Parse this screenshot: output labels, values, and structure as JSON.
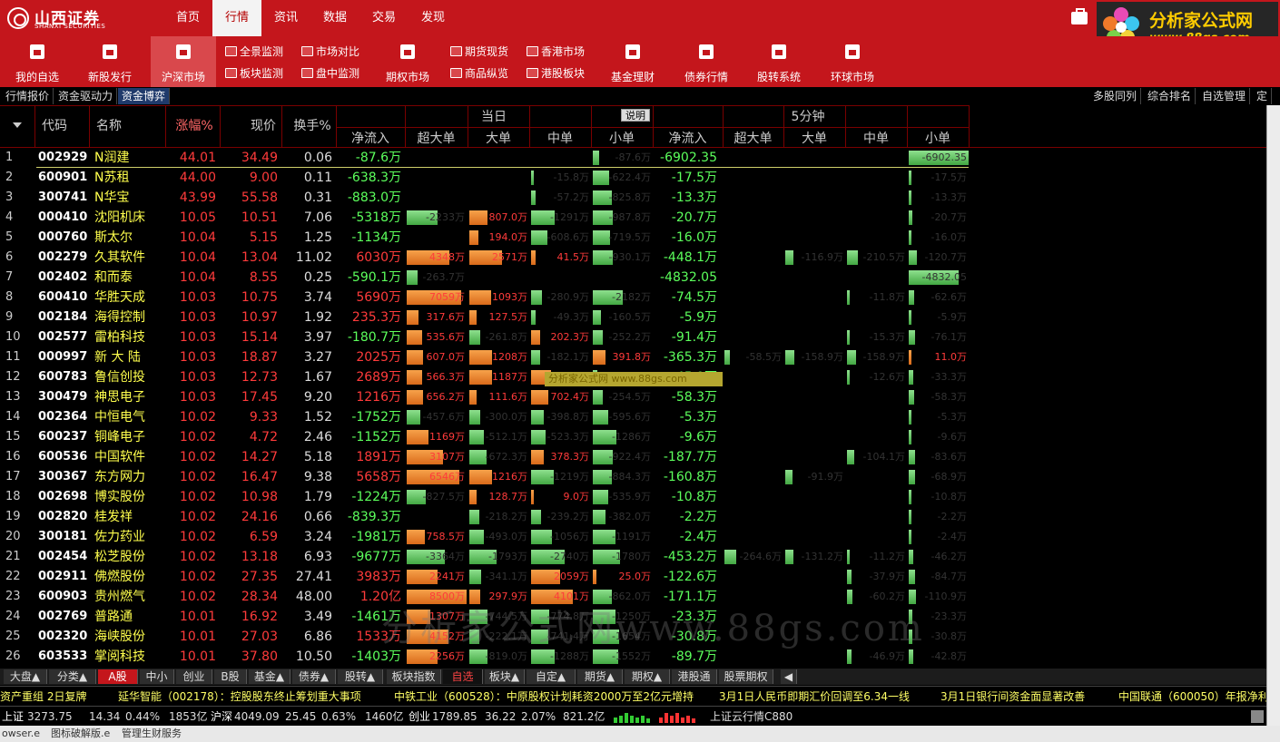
{
  "header": {
    "logo_cn": "山西证券",
    "logo_en": "SHANXI SECURITIES",
    "nav": [
      "首页",
      "行情",
      "资讯",
      "数据",
      "交易",
      "发现"
    ],
    "nav_active": 1,
    "brand_title": "分析家公式网",
    "brand_url": "www.88gs.com"
  },
  "toolbar": {
    "big": [
      {
        "label": "我的自选",
        "icon": "home-icon"
      },
      {
        "label": "新股发行",
        "icon": "document-icon"
      },
      {
        "label": "沪深市场",
        "icon": "chart-icon"
      },
      {
        "label": "期权市场",
        "icon": "options-icon"
      },
      {
        "label": "基金理财",
        "icon": "fund-icon"
      },
      {
        "label": "债券行情",
        "icon": "bond-icon"
      },
      {
        "label": "股转系统",
        "icon": "transfer-icon"
      },
      {
        "label": "环球市场",
        "icon": "globe-icon"
      }
    ],
    "small": [
      "全景监测",
      "板块监测",
      "市场对比",
      "盘中监测",
      "期货现货",
      "商品纵览",
      "香港市场",
      "港股板块"
    ]
  },
  "subtabs": {
    "left": [
      "行情报价",
      "资金驱动力",
      "资金博弈"
    ],
    "right": [
      "多股同列",
      "综合排名",
      "自选管理",
      "定"
    ]
  },
  "table": {
    "headers": {
      "code": "代码",
      "name": "名称",
      "chg": "涨幅%",
      "price": "现价",
      "turnover": "换手%",
      "today": "当日",
      "explain": "说明",
      "five": "5分钟",
      "net": "净流入",
      "xl": "超大单",
      "l": "大单",
      "m": "中单",
      "s": "小单"
    },
    "rows": [
      {
        "i": "1",
        "code": "002929",
        "name": "N润建",
        "chg": "44.01",
        "price": "34.49",
        "to": "0.06",
        "net": "-87.6万",
        "d": [
          "",
          "",
          "",
          "-87.6万"
        ],
        "f": [
          "-6902.35",
          "",
          "",
          "",
          ""
        ],
        "fv": [
          "",
          "",
          "",
          "-6902.35"
        ]
      },
      {
        "i": "2",
        "code": "600901",
        "name": "N苏租",
        "chg": "44.00",
        "price": "9.00",
        "to": "0.11",
        "net": "-638.3万",
        "d": [
          "",
          "",
          "-15.8万",
          "-622.4万"
        ],
        "f": [
          "-17.5万"
        ],
        "fv": [
          "",
          "",
          "",
          "-17.5万"
        ]
      },
      {
        "i": "3",
        "code": "300741",
        "name": "N华宝",
        "chg": "43.99",
        "price": "55.58",
        "to": "0.31",
        "net": "-883.0万",
        "d": [
          "",
          "",
          "-57.2万",
          "-825.8万"
        ],
        "f": [
          "-13.3万"
        ],
        "fv": [
          "",
          "",
          "",
          "-13.3万"
        ]
      },
      {
        "i": "4",
        "code": "000410",
        "name": "沈阳机床",
        "chg": "10.05",
        "price": "10.51",
        "to": "7.06",
        "net": "-5318万",
        "d": [
          "-2233万",
          "807.0万",
          "-1291万",
          "-987.8万"
        ],
        "f": [
          "-20.7万"
        ],
        "fv": [
          "",
          "",
          "",
          "-20.7万"
        ]
      },
      {
        "i": "5",
        "code": "000760",
        "name": "斯太尔",
        "chg": "10.04",
        "price": "5.15",
        "to": "1.25",
        "net": "-1134万",
        "d": [
          "",
          "194.0万",
          "-608.6万",
          "-719.5万"
        ],
        "f": [
          "-16.0万"
        ],
        "fv": [
          "",
          "",
          "",
          "-16.0万"
        ]
      },
      {
        "i": "6",
        "code": "002279",
        "name": "久其软件",
        "chg": "10.04",
        "price": "13.04",
        "to": "11.02",
        "net": "6030万",
        "d": [
          "4348万",
          "2571万",
          "41.5万",
          "-930.1万"
        ],
        "f": [
          "-448.1万"
        ],
        "fv": [
          "",
          "-116.9万",
          "-210.5万",
          "-120.7万"
        ]
      },
      {
        "i": "7",
        "code": "002402",
        "name": "和而泰",
        "chg": "10.04",
        "price": "8.55",
        "to": "0.25",
        "net": "-590.1万",
        "d": [
          "-263.7万",
          "",
          "",
          ""
        ],
        "f": [
          "-4832.05"
        ],
        "fv": [
          "",
          "",
          "",
          "-4832.05"
        ]
      },
      {
        "i": "8",
        "code": "600410",
        "name": "华胜天成",
        "chg": "10.03",
        "price": "10.75",
        "to": "3.74",
        "net": "5690万",
        "d": [
          "7059万",
          "1093万",
          "-280.9万",
          "-2182万"
        ],
        "f": [
          "-74.5万"
        ],
        "fv": [
          "",
          "",
          "-11.8万",
          "-62.6万"
        ]
      },
      {
        "i": "9",
        "code": "002184",
        "name": "海得控制",
        "chg": "10.03",
        "price": "10.97",
        "to": "1.92",
        "net": "235.3万",
        "d": [
          "317.6万",
          "127.5万",
          "-49.3万",
          "-160.5万"
        ],
        "f": [
          "-5.9万"
        ],
        "fv": [
          "",
          "",
          "",
          "-5.9万"
        ]
      },
      {
        "i": "10",
        "code": "002577",
        "name": "雷柏科技",
        "chg": "10.03",
        "price": "15.14",
        "to": "3.97",
        "net": "-180.7万",
        "d": [
          "535.6万",
          "-261.8万",
          "202.3万",
          "-252.2万"
        ],
        "f": [
          "-91.4万"
        ],
        "fv": [
          "",
          "",
          "-15.3万",
          "-76.1万"
        ]
      },
      {
        "i": "11",
        "code": "000997",
        "name": "新 大 陆",
        "chg": "10.03",
        "price": "18.87",
        "to": "3.27",
        "net": "2025万",
        "d": [
          "607.0万",
          "1208万",
          "-182.1万",
          "391.8万"
        ],
        "f": [
          "-365.3万"
        ],
        "fv": [
          "-58.5万",
          "-158.9万",
          "-158.9万",
          "11.0万"
        ]
      },
      {
        "i": "12",
        "code": "600783",
        "name": "鲁信创投",
        "chg": "10.03",
        "price": "12.73",
        "to": "1.67",
        "net": "2689万",
        "d": [
          "566.3万",
          "1187万",
          "977.8万",
          "-42.5万"
        ],
        "f": [
          "-45.9万"
        ],
        "fv": [
          "",
          "",
          "-12.6万",
          "-33.3万"
        ]
      },
      {
        "i": "13",
        "code": "300479",
        "name": "神思电子",
        "chg": "10.03",
        "price": "17.45",
        "to": "9.20",
        "net": "1216万",
        "d": [
          "656.2万",
          "111.6万",
          "702.4万",
          "-254.5万"
        ],
        "f": [
          "-58.3万"
        ],
        "fv": [
          "",
          "",
          "",
          "-58.3万"
        ]
      },
      {
        "i": "14",
        "code": "002364",
        "name": "中恒电气",
        "chg": "10.02",
        "price": "9.33",
        "to": "1.52",
        "net": "-1752万",
        "d": [
          "-457.6万",
          "-300.0万",
          "-398.8万",
          "-595.6万"
        ],
        "f": [
          "-5.3万"
        ],
        "fv": [
          "",
          "",
          "",
          "-5.3万"
        ]
      },
      {
        "i": "15",
        "code": "600237",
        "name": "铜峰电子",
        "chg": "10.02",
        "price": "4.72",
        "to": "2.46",
        "net": "-1152万",
        "d": [
          "1169万",
          "-512.1万",
          "-523.3万",
          "-1286万"
        ],
        "f": [
          "-9.6万"
        ],
        "fv": [
          "",
          "",
          "",
          "-9.6万"
        ]
      },
      {
        "i": "16",
        "code": "600536",
        "name": "中国软件",
        "chg": "10.02",
        "price": "14.27",
        "to": "5.18",
        "net": "1891万",
        "d": [
          "3107万",
          "-672.3万",
          "378.3万",
          "-922.4万"
        ],
        "f": [
          "-187.7万"
        ],
        "fv": [
          "",
          "",
          "-104.1万",
          "-83.6万"
        ]
      },
      {
        "i": "17",
        "code": "300367",
        "name": "东方网力",
        "chg": "10.02",
        "price": "16.47",
        "to": "9.38",
        "net": "5658万",
        "d": [
          "6546万",
          "1216万",
          "-1219万",
          "-884.3万"
        ],
        "f": [
          "-160.8万"
        ],
        "fv": [
          "",
          "-91.9万",
          "",
          "-68.9万"
        ]
      },
      {
        "i": "18",
        "code": "002698",
        "name": "博实股份",
        "chg": "10.02",
        "price": "10.98",
        "to": "1.79",
        "net": "-1224万",
        "d": [
          "-827.5万",
          "128.7万",
          "9.0万",
          "-535.9万"
        ],
        "f": [
          "-10.8万"
        ],
        "fv": [
          "",
          "",
          "",
          "-10.8万"
        ]
      },
      {
        "i": "19",
        "code": "002820",
        "name": "桂发祥",
        "chg": "10.02",
        "price": "24.16",
        "to": "0.66",
        "net": "-839.3万",
        "d": [
          "",
          "-218.2万",
          "-239.2万",
          "-382.0万"
        ],
        "f": [
          "-2.2万"
        ],
        "fv": [
          "",
          "",
          "",
          "-2.2万"
        ]
      },
      {
        "i": "20",
        "code": "300181",
        "name": "佐力药业",
        "chg": "10.02",
        "price": "6.59",
        "to": "3.24",
        "net": "-1981万",
        "d": [
          "758.5万",
          "-493.0万",
          "-1056万",
          "-1191万"
        ],
        "f": [
          "-2.4万"
        ],
        "fv": [
          "",
          "",
          "",
          "-2.4万"
        ]
      },
      {
        "i": "21",
        "code": "002454",
        "name": "松芝股份",
        "chg": "10.02",
        "price": "13.18",
        "to": "6.93",
        "net": "-9677万",
        "d": [
          "-3364万",
          "-1793万",
          "-2740万",
          "-1780万"
        ],
        "f": [
          "-453.2万"
        ],
        "fv": [
          "-264.6万",
          "-131.2万",
          "-11.2万",
          "-46.2万"
        ]
      },
      {
        "i": "22",
        "code": "002911",
        "name": "佛燃股份",
        "chg": "10.02",
        "price": "27.35",
        "to": "27.41",
        "net": "3983万",
        "d": [
          "2241万",
          "-341.1万",
          "2059万",
          "25.0万"
        ],
        "f": [
          "-122.6万"
        ],
        "fv": [
          "",
          "",
          "-37.9万",
          "-84.7万"
        ]
      },
      {
        "i": "23",
        "code": "600903",
        "name": "贵州燃气",
        "chg": "10.02",
        "price": "28.34",
        "to": "48.00",
        "net": "1.20亿",
        "d": [
          "8500万",
          "297.9万",
          "4101万",
          "-862.0万"
        ],
        "f": [
          "-171.1万"
        ],
        "fv": [
          "",
          "",
          "-60.2万",
          "-110.9万"
        ]
      },
      {
        "i": "24",
        "code": "002769",
        "name": "普路通",
        "chg": "10.01",
        "price": "16.92",
        "to": "3.49",
        "net": "-1461万",
        "d": [
          "1307万",
          "-744.5万",
          "-774.8万",
          "-1250万"
        ],
        "f": [
          "-23.3万"
        ],
        "fv": [
          "",
          "",
          "",
          "-23.3万"
        ]
      },
      {
        "i": "25",
        "code": "002320",
        "name": "海峡股份",
        "chg": "10.01",
        "price": "27.03",
        "to": "6.86",
        "net": "1533万",
        "d": [
          "4152万",
          "-222.1万",
          "-741.4万",
          "-1654万"
        ],
        "f": [
          "-30.8万"
        ],
        "fv": [
          "",
          "",
          "",
          "-30.8万"
        ]
      },
      {
        "i": "26",
        "code": "603533",
        "name": "掌阅科技",
        "chg": "10.01",
        "price": "37.80",
        "to": "10.50",
        "net": "-1403万",
        "d": [
          "2256万",
          "-819.0万",
          "-1288万",
          "-1552万"
        ],
        "f": [
          "-89.7万"
        ],
        "fv": [
          "",
          "",
          "-46.9万",
          "-42.8万"
        ]
      }
    ]
  },
  "tooltip": "分析家公式网 www.88gs.com",
  "watermark": "分析家公式网www.88gs.com",
  "bottom_tabs": [
    "大盘▲",
    "分类▲",
    "A股",
    "中小",
    "创业",
    "B股",
    "基金▲",
    "债券▲",
    "股转▲",
    "板块指数",
    "自选",
    "板块▲",
    "自定▲",
    "期货▲",
    "期权▲",
    "港股通",
    "股票期权"
  ],
  "ticker": [
    "资产重组 2日复牌",
    "延华智能（002178）：控股股东终止筹划重大事项",
    "中铁工业（600528）：中原股权计划耗资2000万至2亿元增持",
    "3月1日人民币即期汇价回调至6.34一线",
    "3月1日银行间资金面显著改善",
    "中国联通（600050）年报净利润"
  ],
  "status": {
    "sh_label": "上证",
    "sh_val": "3273.75",
    "sh_chg": "14.34",
    "sh_pct": "0.44%",
    "sh_amt": "1853亿",
    "hs_label": "沪深",
    "hs_val": "4049.09",
    "hs_chg": "25.45",
    "hs_pct": "0.63%",
    "hs_amt": "1460亿",
    "cy_label": "创业",
    "cy_val": "1789.85",
    "cy_chg": "36.22",
    "cy_pct": "2.07%",
    "cy_amt": "821.2亿",
    "server": "上证云行情C880"
  },
  "taskbar": [
    "owser.e",
    "图标破解版.e",
    "管理生财服务"
  ]
}
